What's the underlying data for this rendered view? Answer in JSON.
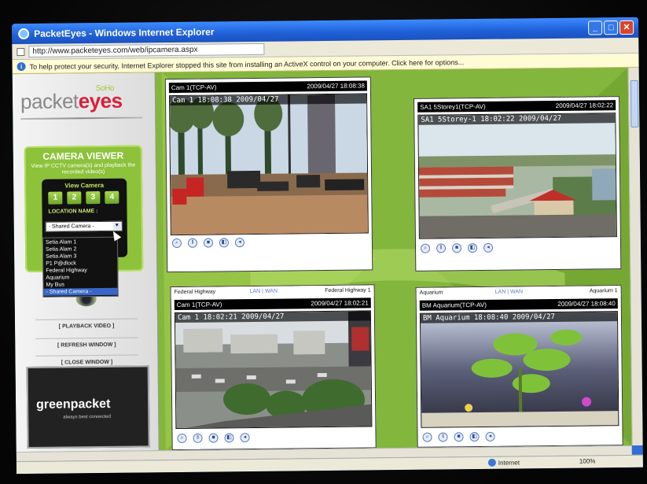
{
  "window": {
    "title": "PacketEyes - Windows Internet Explorer",
    "url": "http://www.packeteyes.com/web/ipcamera.aspx",
    "infobar": "To help protect your security, Internet Explorer stopped this site from installing an ActiveX control on your computer. Click here for options..."
  },
  "sidebar": {
    "logo_text": "packet",
    "logo_eyes": "eyes",
    "logo_soho": "SoHo",
    "viewer_title": "CAMERA VIEWER",
    "viewer_subtitle": "View IP CCTV camera(s) and playback the recorded video(s)",
    "view_camera_label": "View Camera",
    "camera_numbers": [
      "1",
      "2",
      "3",
      "4"
    ],
    "location_label": "LOCATION NAME :",
    "location_selected": "- Shared Camera -",
    "location_options": [
      "Setia Alam 1",
      "Setia Alam 2",
      "Setia Alam 3",
      "P1 P@dlock",
      "Federal Highway",
      "Aquarium",
      "My Bus",
      "- Shared Camera -"
    ],
    "buttons": {
      "playback": "[ PLAYBACK VIDEO ]",
      "refresh": "[ REFRESH WINDOW ]",
      "close": "[ CLOSE WINDOW ]"
    },
    "sponsor_logo": "greenpacket",
    "sponsor_tag": "always best connected"
  },
  "panes": [
    {
      "camera_name": "Cam 1(TCP-AV)",
      "timestamp": "2009/04/27 18:08:38",
      "osd": "Cam 1 18:08:38 2009/04/27"
    },
    {
      "camera_name": "SA1 5Storey1(TCP-AV)",
      "timestamp": "2009/04/27 18:02:22",
      "osd": "SA1 5Storey-1 18:02:22 2009/04/27"
    },
    {
      "header_title": "Federal Highway",
      "header_links": "LAN | WAN",
      "header_right": "Federal Highway 1",
      "camera_name": "Cam 1(TCP-AV)",
      "timestamp": "2009/04/27 18:02:21",
      "osd": "Cam 1 18:02:21 2009/04/27"
    },
    {
      "header_title": "Aquarium",
      "header_links": "LAN | WAN",
      "header_right": "Aquarium 1",
      "camera_name": "BM Aquarium(TCP-AV)",
      "timestamp": "2009/04/27 18:08:40",
      "osd": "BM Aquarium 18:08:40 2009/04/27"
    }
  ],
  "controls_icons": [
    "magnifier-icon",
    "pause-icon",
    "stop-icon",
    "snapshot-icon",
    "audio-icon"
  ],
  "status": {
    "zone": "Internet",
    "zoom": "100%"
  }
}
